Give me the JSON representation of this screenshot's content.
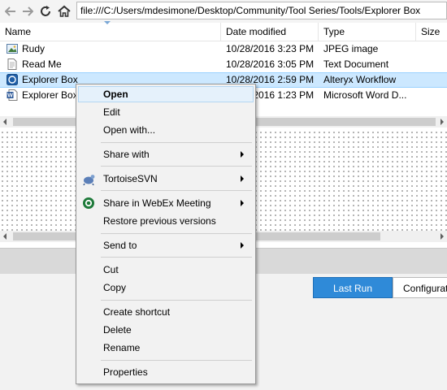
{
  "address": {
    "path": "file:///C:/Users/mdesimone/Desktop/Community/Tool Series/Tools/Explorer Box"
  },
  "columns": {
    "name": "Name",
    "date_modified": "Date modified",
    "type": "Type",
    "size": "Size"
  },
  "files": [
    {
      "name": "Rudy",
      "date": "10/28/2016 3:23 PM",
      "type": "JPEG image",
      "icon": "image-file-icon"
    },
    {
      "name": "Read Me",
      "date": "10/28/2016 3:05 PM",
      "type": "Text Document",
      "icon": "text-file-icon"
    },
    {
      "name": "Explorer Box",
      "date": "10/28/2016 2:59 PM",
      "type": "Alteryx Workflow",
      "icon": "alteryx-workflow-icon"
    },
    {
      "name": "Explorer Box",
      "date": "10/28/2016 1:23 PM",
      "type": "Microsoft Word D...",
      "icon": "word-document-icon"
    }
  ],
  "bottom_tabs": {
    "last_run": "Last Run",
    "configuration": "Configurati"
  },
  "context_menu": {
    "open": "Open",
    "edit": "Edit",
    "open_with": "Open with...",
    "share_with": "Share with",
    "tortoisesvn": "TortoiseSVN",
    "share_webex": "Share in WebEx Meeting",
    "restore_versions": "Restore previous versions",
    "send_to": "Send to",
    "cut": "Cut",
    "copy": "Copy",
    "create_shortcut": "Create shortcut",
    "delete": "Delete",
    "rename": "Rename",
    "properties": "Properties"
  },
  "colors": {
    "selection": "#cce8ff",
    "accent": "#2f8ad8",
    "menu_bg": "#f2f2f2"
  }
}
